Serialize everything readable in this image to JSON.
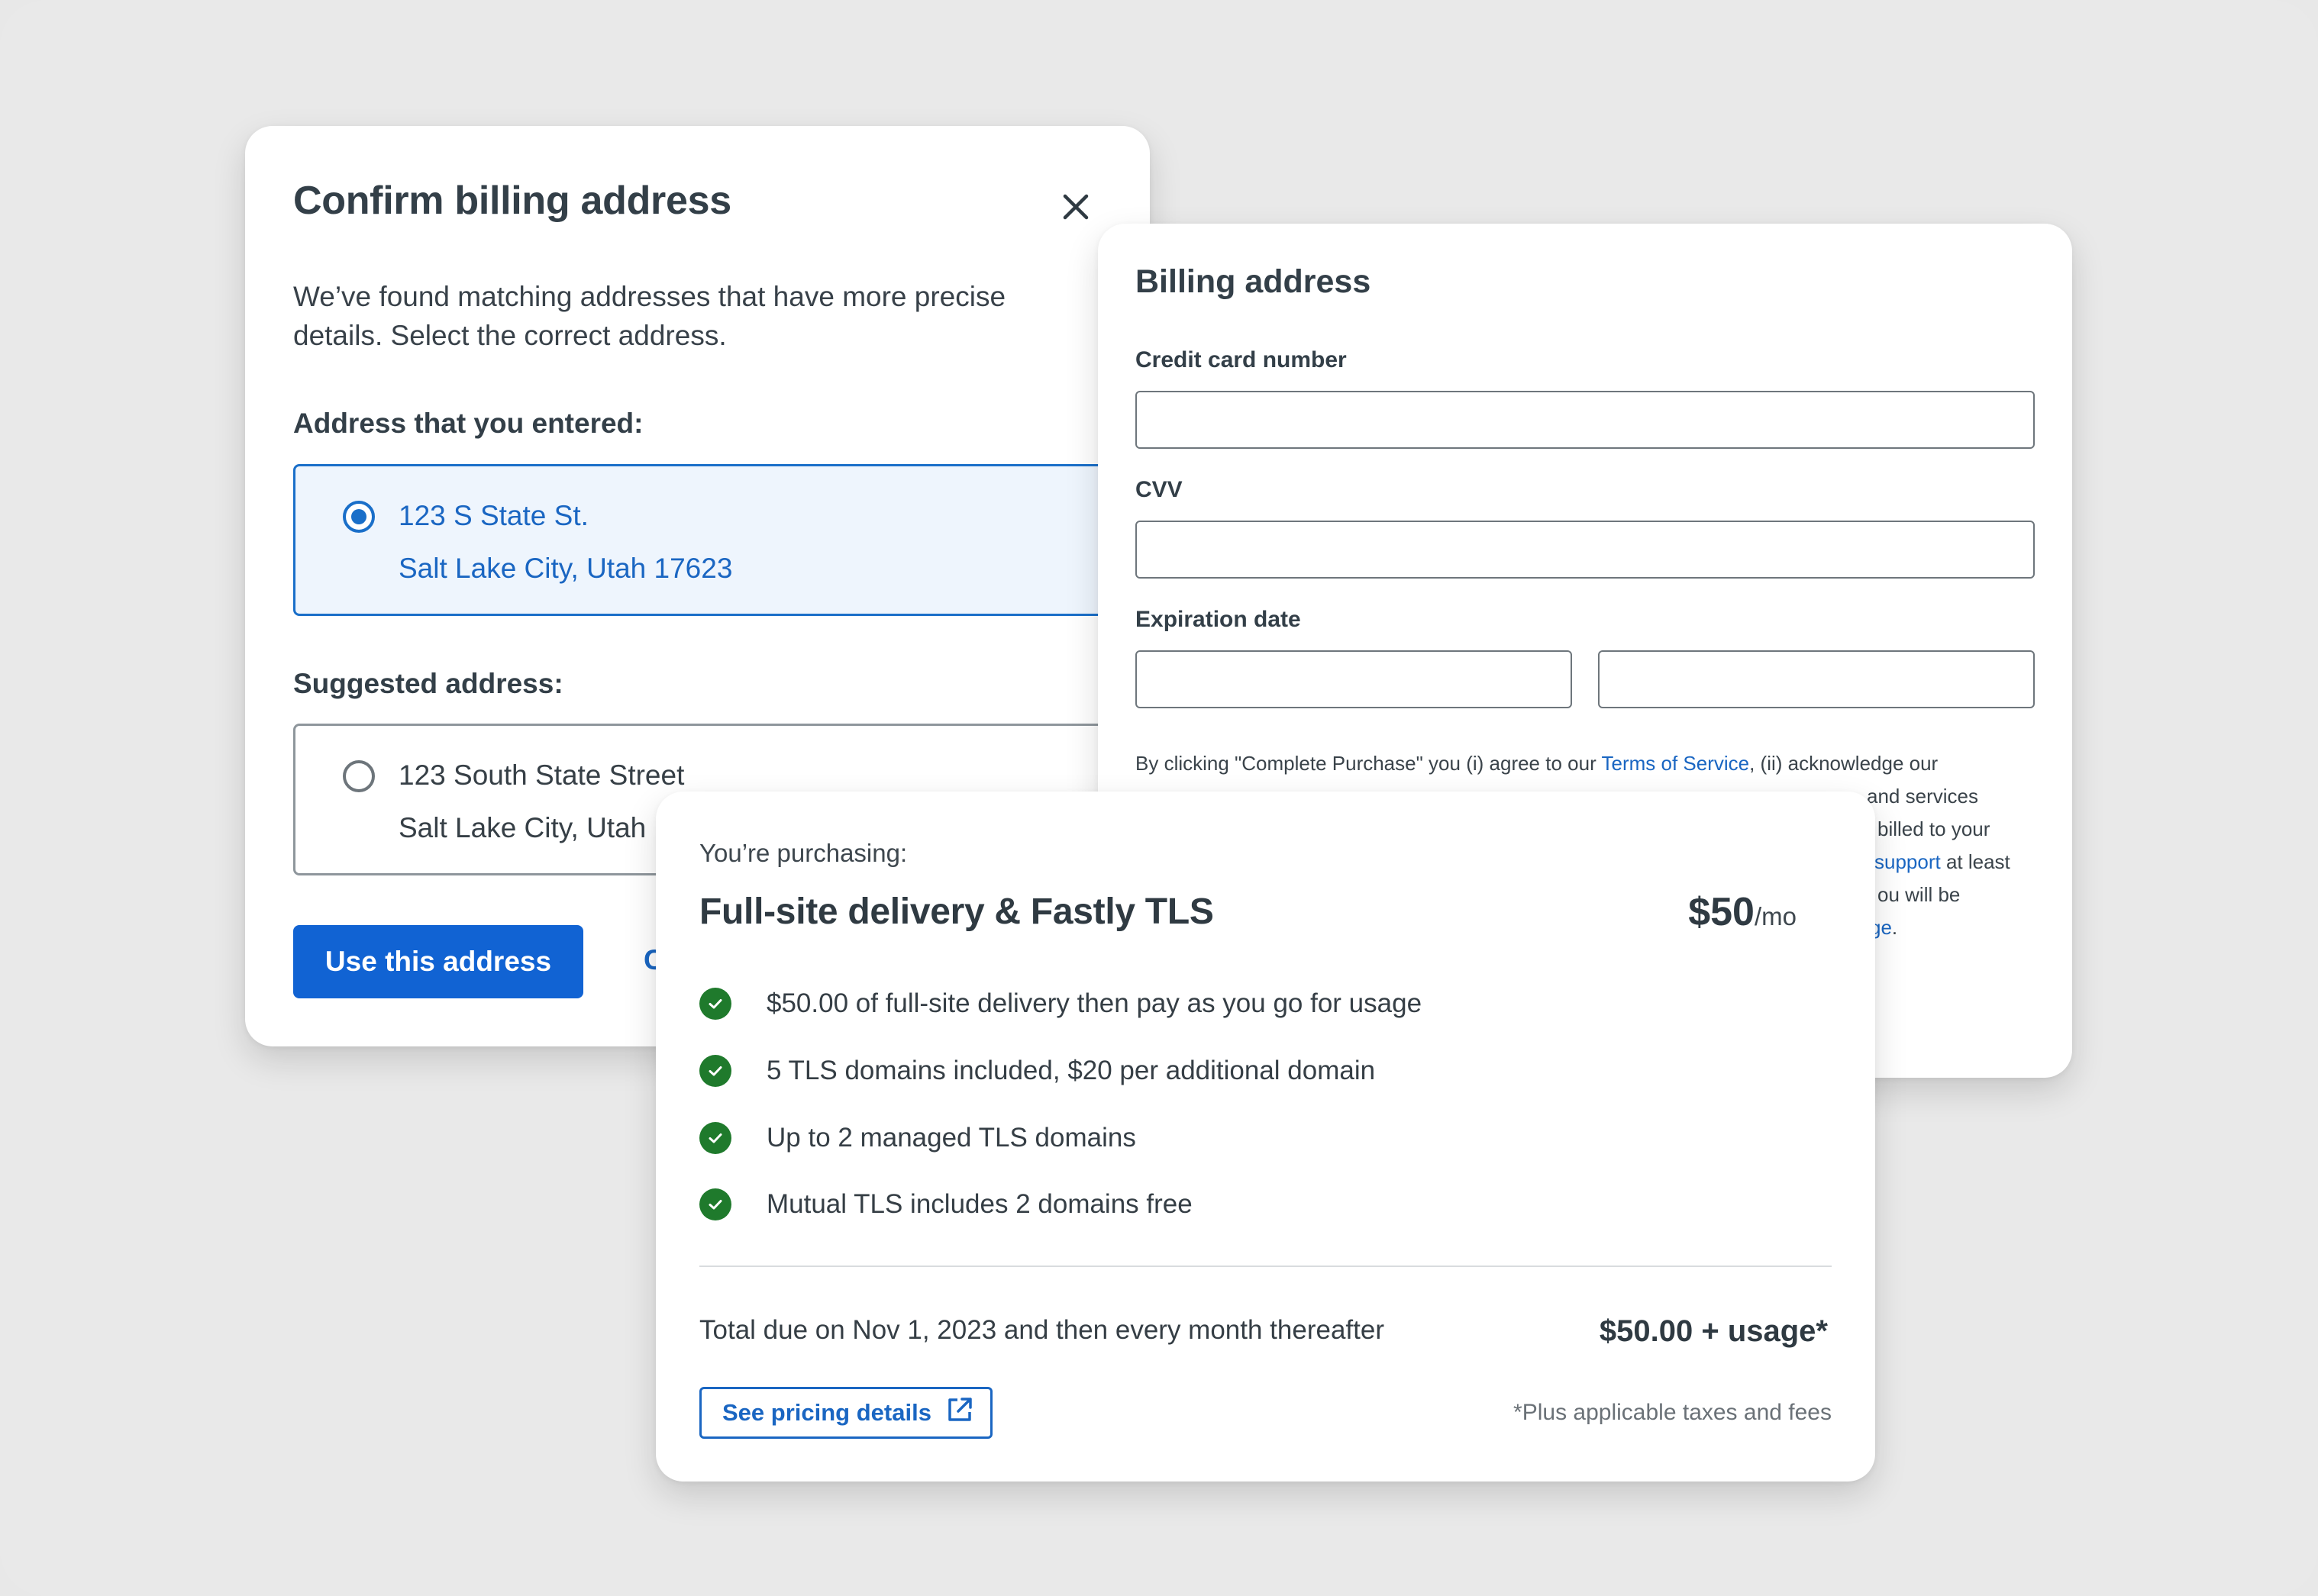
{
  "confirm_dialog": {
    "title": "Confirm billing address",
    "description": "We’ve found matching addresses that have more precise details. Select the correct address.",
    "entered_label": "Address that you entered:",
    "entered_address": {
      "line1": "123 S State St.",
      "line2": "Salt Lake City, Utah 17623",
      "selected": true
    },
    "suggested_label": "Suggested address:",
    "suggested_address": {
      "line1": "123 South State Street",
      "line2": "Salt Lake City, Utah",
      "selected": false
    },
    "use_button": "Use this address",
    "cancel_button": "C",
    "close_icon": "close-icon"
  },
  "billing_form": {
    "title": "Billing address",
    "card_number_label": "Credit card number",
    "cvv_label": "CVV",
    "expiration_label": "Expiration date",
    "legal": {
      "line1_pre": "By clicking \"Complete Purchase\" you (i) agree to our ",
      "terms_link": "Terms of Service",
      "line1_post": ", (ii) acknowledge our",
      "line2_tail": "and services",
      "line3_tail": "billed to your",
      "support_link": "support",
      "line4_tail": " at least",
      "line5_tail": "ou will be",
      "line6_link": "ge",
      "line6_tail": "."
    }
  },
  "purchase_card": {
    "kicker": "You’re purchasing:",
    "product_name": "Full-site delivery & Fastly TLS",
    "price": "$50",
    "price_period": "/mo",
    "features": [
      "$50.00 of full-site delivery then pay as you go for usage",
      "5 TLS domains included, $20 per additional domain",
      "Up to 2 managed TLS domains",
      "Mutual TLS includes 2 domains free"
    ],
    "feature_icon": "check-circle-icon",
    "total_label": "Total due on Nov 1, 2023 and then every month thereafter",
    "total_value": "$50.00 + usage*",
    "pricing_button": "See pricing details",
    "pricing_button_icon": "external-link-icon",
    "taxes_note": "*Plus applicable taxes and fees"
  },
  "colors": {
    "primary": "#1163d3",
    "link": "#1a66c2",
    "success": "#1f7a2c",
    "background": "#e9e9e9"
  }
}
